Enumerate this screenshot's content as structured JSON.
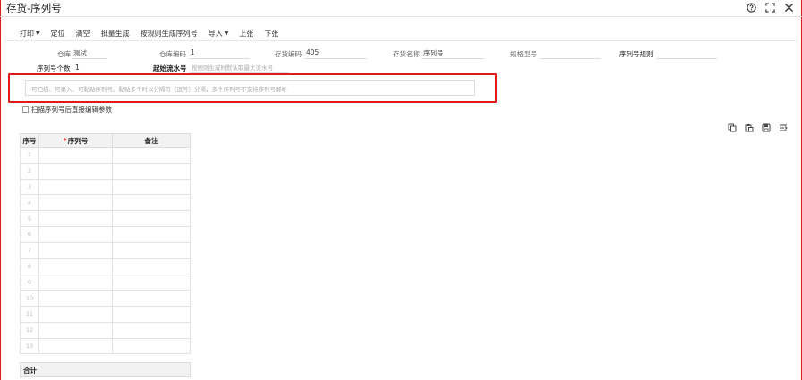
{
  "window": {
    "title": "存货-序列号"
  },
  "toolbar": {
    "print": "打印",
    "locate": "定位",
    "clear": "清空",
    "batch_generate": "批量生成",
    "rule_generate": "按规则生成序列号",
    "import": "导入",
    "prev": "上张",
    "next": "下张"
  },
  "fields": {
    "warehouse": {
      "label": "仓库",
      "value": "测试"
    },
    "warehouse_code": {
      "label": "仓库编码",
      "value": "1"
    },
    "item_code": {
      "label": "存货编码",
      "value": "405"
    },
    "item_name": {
      "label": "存货名称",
      "value": "序列号"
    },
    "spec": {
      "label": "规格型号",
      "value": ""
    },
    "serial_rule": {
      "label": "序列号规则",
      "value": ""
    },
    "serial_count": {
      "label": "序列号个数",
      "value": "1"
    },
    "start_seq": {
      "label": "起始流水号",
      "placeholder": "按规则生成时默认取最大流水号"
    }
  },
  "serial_input": {
    "placeholder": "可扫描、可录入、可黏贴序列号。黏贴多个时以分隔符（逗号）分隔，多个序列号不支持序列号解析"
  },
  "checkbox": {
    "label": "扫描序列号后直接编辑参数",
    "checked": false
  },
  "grid": {
    "headers": [
      "序号",
      "序列号",
      "备注"
    ],
    "required_mark": "*",
    "rows": [
      "1",
      "2",
      "3",
      "4",
      "5",
      "6",
      "7",
      "8",
      "9",
      "10",
      "11",
      "12",
      "13"
    ],
    "total_label": "合计"
  },
  "icons": {
    "help": "help-icon",
    "maximize": "maximize-icon",
    "close": "close-icon",
    "copy": "copy-icon",
    "paste": "paste-icon",
    "save": "save-icon",
    "settings": "column-settings-icon"
  },
  "colors": {
    "highlight": "#e11a1a",
    "header_bg": "#f2f2f2"
  }
}
